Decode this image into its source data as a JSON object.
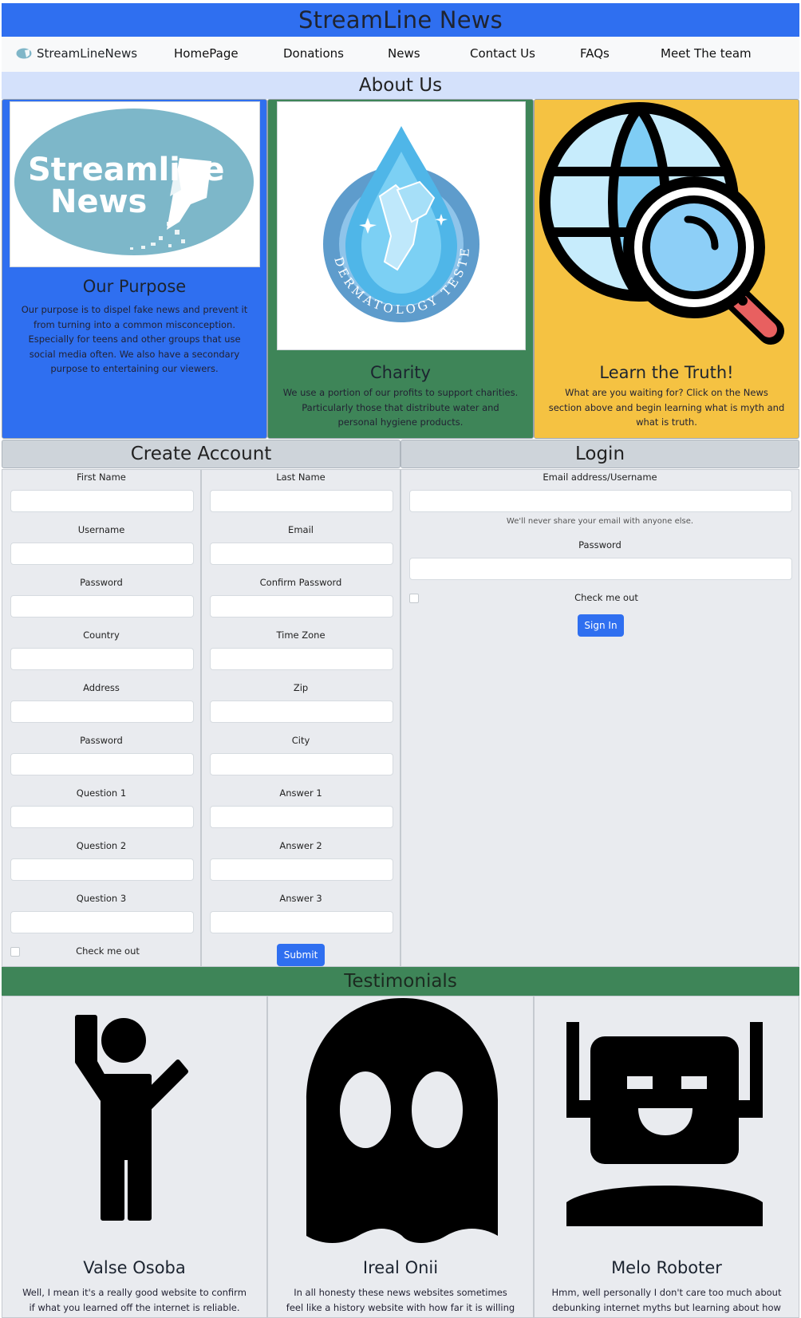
{
  "site": {
    "title": "StreamLine News"
  },
  "nav": {
    "brand": "StreamLineNews",
    "links": [
      "HomePage",
      "Donations",
      "News",
      "Contact Us",
      "FAQs",
      "Meet The team"
    ]
  },
  "about": {
    "heading": "About Us",
    "cards": [
      {
        "title": "Our Purpose",
        "text": "Our purpose is to dispel fake news and prevent it from turning into a common misconception. Especially for teens and other groups that use social media often. We also have a secondary purpose to entertaining our viewers.",
        "logo_lines": [
          "Streamline",
          "News"
        ],
        "bg": "#2f6ff0"
      },
      {
        "title": "Charity",
        "text": "We use a portion of our profits to support charities. Particularly those that distribute water and personal hygiene products.",
        "badge_text": "DERMATOLOGY TESTED",
        "bg": "#3e8558"
      },
      {
        "title": "Learn the Truth!",
        "text": "What are you waiting for? Click on the News section above and begin learning what is myth and what is truth.",
        "bg": "#f5c242"
      }
    ]
  },
  "create_account": {
    "heading": "Create Account",
    "left_labels": [
      "First Name",
      "Username",
      "Password",
      "Country",
      "Address",
      "Password",
      "Question 1",
      "Question 2",
      "Question 3"
    ],
    "right_labels": [
      "Last Name",
      "Email",
      "Confirm Password",
      "Time Zone",
      "Zip",
      "City",
      "Answer 1",
      "Answer 2",
      "Answer 3"
    ],
    "checkbox_label": "Check me out",
    "submit_label": "Submit"
  },
  "login": {
    "heading": "Login",
    "email_label": "Email address/Username",
    "email_help": "We'll never share your email with anyone else.",
    "password_label": "Password",
    "checkbox_label": "Check me out",
    "signin_label": "Sign In"
  },
  "testimonials": {
    "heading": "Testimonials",
    "items": [
      {
        "name": "Valse Osoba",
        "icon": "person-waving-icon",
        "text": "Well, I mean it's a really good website to confirm if what you learned off the internet is reliable."
      },
      {
        "name": "Ireal Onii",
        "icon": "ghost-icon",
        "text": "In all honesty these news websites sometimes feel like a history website with how far it is willing to chase the rest of the fake news."
      },
      {
        "name": "Melo Roboter",
        "icon": "robot-icon",
        "text": "Hmm, well personally I don't care too much about debunking internet myths but learning about how they came to be was really entertaining."
      }
    ]
  },
  "colors": {
    "primary_blue": "#2f6ff0",
    "green": "#3e8558",
    "yellow": "#f5c242",
    "light_blue": "#d4e1fb",
    "form_grey": "#e9ebef"
  }
}
